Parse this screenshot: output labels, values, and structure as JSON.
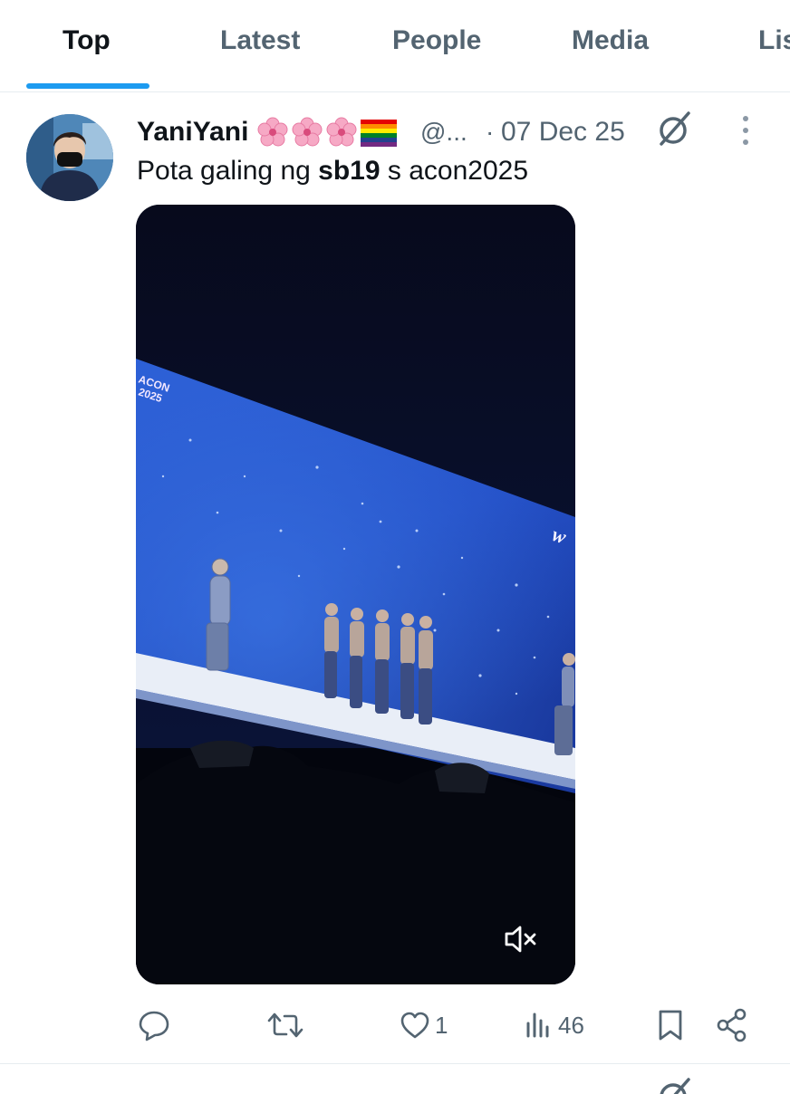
{
  "tabs": [
    {
      "label": "Top",
      "active": true
    },
    {
      "label": "Latest",
      "active": false
    },
    {
      "label": "People",
      "active": false
    },
    {
      "label": "Media",
      "active": false
    },
    {
      "label": "Lis",
      "active": false
    }
  ],
  "tweet": {
    "author": {
      "display_name": "YaniYani",
      "name_emojis": [
        "cherry-blossom",
        "cherry-blossom",
        "cherry-blossom",
        "rainbow-flag"
      ],
      "handle": "@...",
      "avatar_icon": "user-avatar"
    },
    "separator": "·",
    "date": "07 Dec 25",
    "text": {
      "before": "Pota galing ng ",
      "hashtag": "sb19",
      "after": " s acon2025"
    },
    "media": {
      "type": "video",
      "muted": true,
      "screen_logo_text": "ACON 2025"
    },
    "actions": {
      "reply": {
        "icon": "reply-icon",
        "count": ""
      },
      "retweet": {
        "icon": "retweet-icon",
        "count": ""
      },
      "like": {
        "icon": "heart-icon",
        "count": "1"
      },
      "views": {
        "icon": "views-icon",
        "count": "46"
      },
      "bookmark": {
        "icon": "bookmark-icon"
      },
      "share": {
        "icon": "share-icon"
      }
    }
  },
  "colors": {
    "accent": "#1d9bf0",
    "secondary_text": "#536471",
    "primary_text": "#0f1419",
    "divider": "#e6ecf0"
  }
}
